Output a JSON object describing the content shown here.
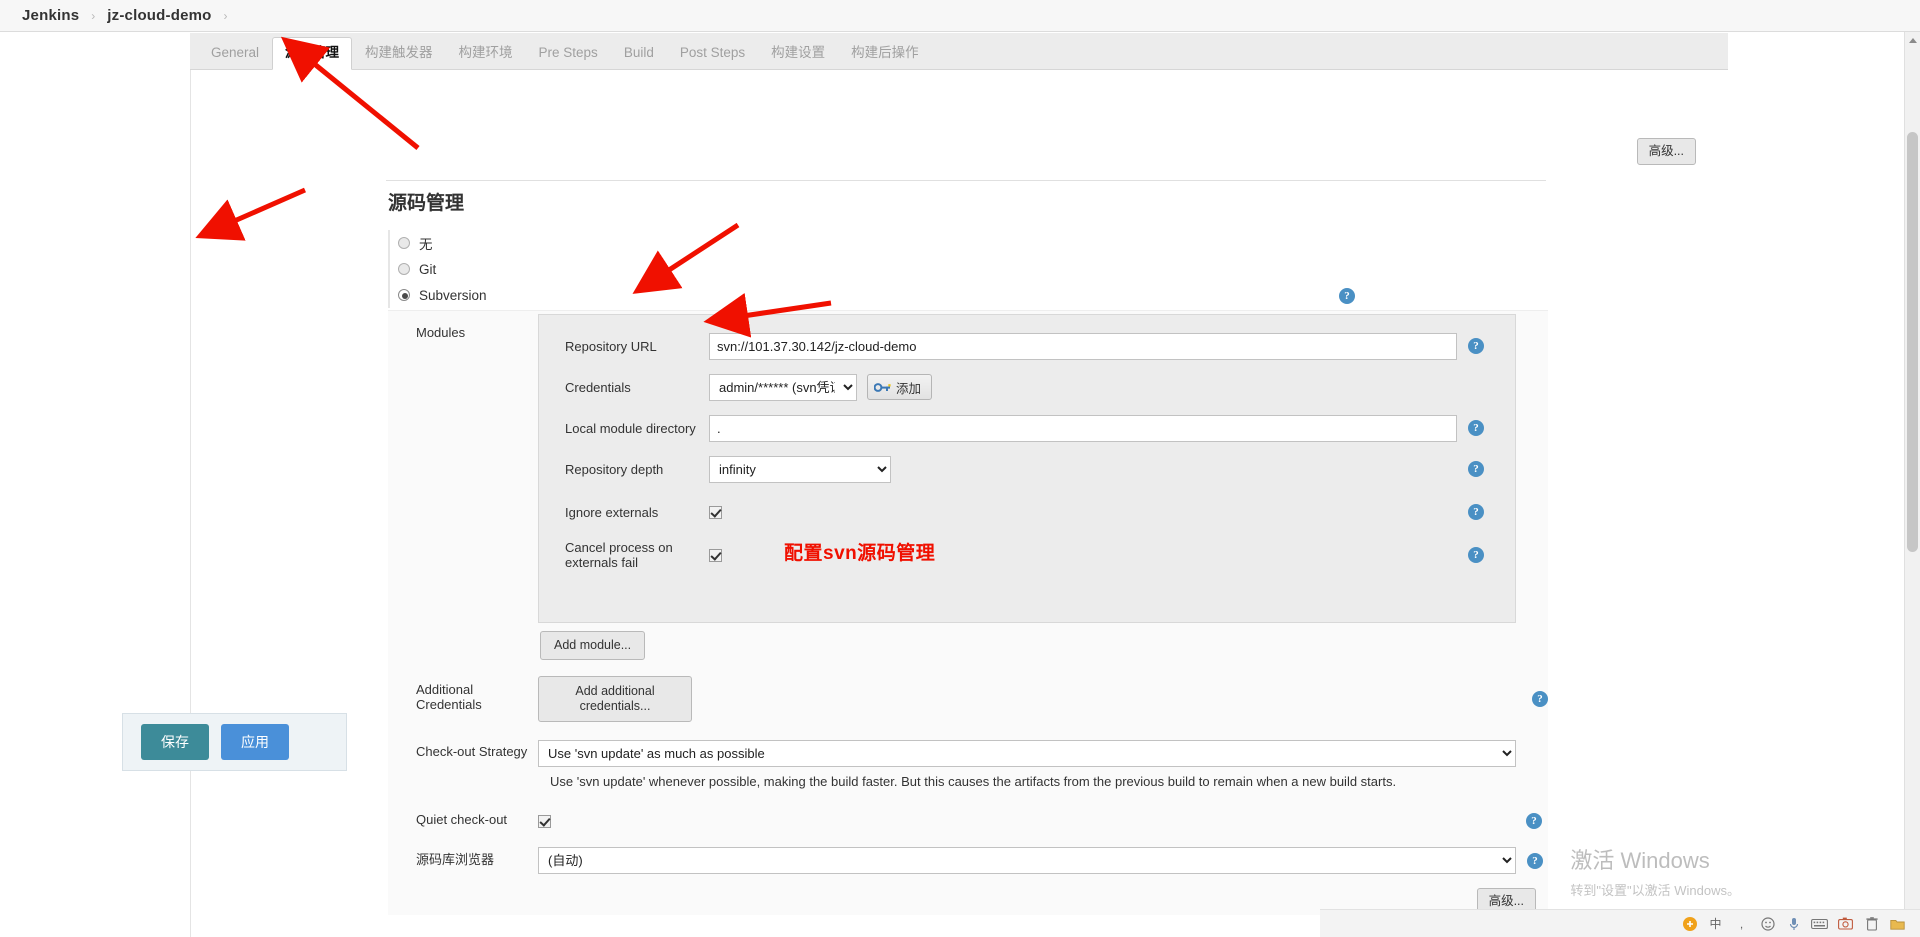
{
  "breadcrumb": {
    "items": [
      "Jenkins",
      "jz-cloud-demo"
    ],
    "separator": "›"
  },
  "tabs": [
    {
      "label": "General",
      "active": false
    },
    {
      "label": "源码管理",
      "active": true
    },
    {
      "label": "构建触发器",
      "active": false
    },
    {
      "label": "构建环境",
      "active": false
    },
    {
      "label": "Pre Steps",
      "active": false
    },
    {
      "label": "Build",
      "active": false
    },
    {
      "label": "Post Steps",
      "active": false
    },
    {
      "label": "构建设置",
      "active": false
    },
    {
      "label": "构建后操作",
      "active": false
    }
  ],
  "buttons": {
    "advanced_top": "高级...",
    "advanced_bottom": "高级...",
    "add_module": "Add module...",
    "add_additional_credentials": "Add additional credentials...",
    "add_credentials": "添加",
    "save": "保存",
    "apply": "应用"
  },
  "section": {
    "title": "源码管理",
    "scm_options": [
      {
        "label": "无",
        "selected": false
      },
      {
        "label": "Git",
        "selected": false
      },
      {
        "label": "Subversion",
        "selected": true
      }
    ]
  },
  "modules": {
    "label": "Modules",
    "fields": [
      {
        "label": "Repository URL",
        "value": "svn://101.37.30.142/jz-cloud-demo",
        "type": "text"
      },
      {
        "label": "Credentials",
        "value": "admin/****** (svn凭证)",
        "type": "select"
      },
      {
        "label": "Local module directory",
        "value": ".",
        "type": "text"
      },
      {
        "label": "Repository depth",
        "value": "infinity",
        "type": "select"
      },
      {
        "label": "Ignore externals",
        "value": "",
        "type": "checkbox",
        "checked": true
      },
      {
        "label": "Cancel process on externals fail",
        "value": "",
        "type": "checkbox",
        "checked": true
      }
    ]
  },
  "additional_credentials": {
    "label": "Additional Credentials"
  },
  "checkout_strategy": {
    "label": "Check-out Strategy",
    "value": "Use 'svn update' as much as possible",
    "description": "Use 'svn update' whenever possible, making the build faster. But this causes the artifacts from the previous build to remain when a new build starts."
  },
  "quiet_checkout": {
    "label": "Quiet check-out",
    "checked": true
  },
  "repo_browser": {
    "label": "源码库浏览器",
    "value": "(自动)"
  },
  "annotation": {
    "text": "配置svn源码管理",
    "color": "#f01000"
  },
  "watermark": {
    "line1": "激活 Windows",
    "line2": "转到\"设置\"以激活 Windows。"
  },
  "taskbar": {
    "ime": "中",
    "icons": [
      "ime-icon",
      "smiley-icon",
      "mic-icon",
      "keyboard-icon",
      "screenshot-icon",
      "trash-icon",
      "folder-icon"
    ]
  },
  "colors": {
    "accent_blue": "#4a90d9",
    "save_teal": "#3d8b99",
    "help_blue": "#4a90c4",
    "annotation_red": "#f01000"
  }
}
